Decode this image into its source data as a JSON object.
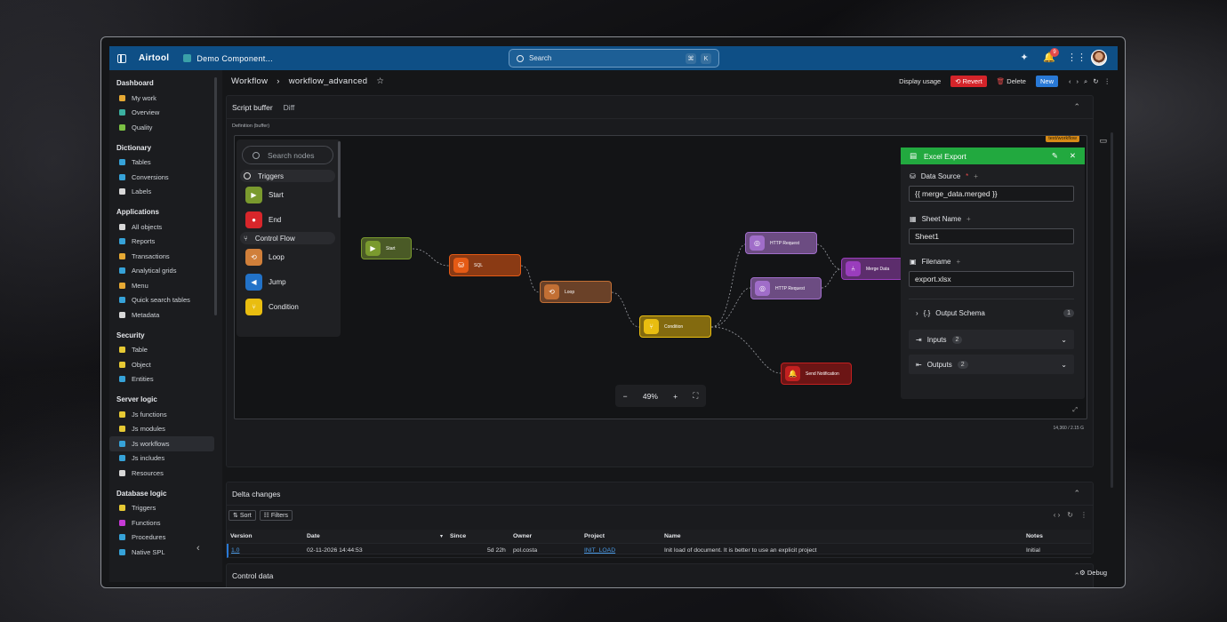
{
  "app": {
    "brand": "Airtool",
    "project": "Demo Component...",
    "search_placeholder": "Search",
    "kbd1": "⌘",
    "kbd2": "K",
    "notif_count": "9"
  },
  "sidebar": {
    "groups": [
      {
        "title": "Dashboard",
        "items": [
          {
            "label": "My work",
            "color": "#e6a934"
          },
          {
            "label": "Overview",
            "color": "#3bb0a0"
          },
          {
            "label": "Quality",
            "color": "#7bc043"
          }
        ]
      },
      {
        "title": "Dictionary",
        "items": [
          {
            "label": "Tables",
            "color": "#36a2d8"
          },
          {
            "label": "Conversions",
            "color": "#36a2d8"
          },
          {
            "label": "Labels",
            "color": "#d8d8d8"
          }
        ]
      },
      {
        "title": "Applications",
        "items": [
          {
            "label": "All objects",
            "color": "#d8d8d8"
          },
          {
            "label": "Reports",
            "color": "#36a2d8"
          },
          {
            "label": "Transactions",
            "color": "#e6a934"
          },
          {
            "label": "Analytical grids",
            "color": "#36a2d8"
          },
          {
            "label": "Menu",
            "color": "#e6a934"
          },
          {
            "label": "Quick search tables",
            "color": "#36a2d8"
          },
          {
            "label": "Metadata",
            "color": "#d8d8d8"
          }
        ]
      },
      {
        "title": "Security",
        "items": [
          {
            "label": "Table",
            "color": "#e6c934"
          },
          {
            "label": "Object",
            "color": "#e6c934"
          },
          {
            "label": "Entities",
            "color": "#36a2d8"
          }
        ]
      },
      {
        "title": "Server logic",
        "items": [
          {
            "label": "Js functions",
            "color": "#e6c934"
          },
          {
            "label": "Js modules",
            "color": "#e6c934"
          },
          {
            "label": "Js workflows",
            "color": "#36a2d8"
          },
          {
            "label": "Js includes",
            "color": "#36a2d8"
          },
          {
            "label": "Resources",
            "color": "#d8d8d8"
          }
        ]
      },
      {
        "title": "Database logic",
        "items": [
          {
            "label": "Triggers",
            "color": "#e6c934"
          },
          {
            "label": "Functions",
            "color": "#c63ad6"
          },
          {
            "label": "Procedures",
            "color": "#36a2d8"
          },
          {
            "label": "Native SPL",
            "color": "#36a2d8"
          }
        ]
      }
    ]
  },
  "header": {
    "crumb1": "Workflow",
    "crumb_sep": "›",
    "crumb2": "workflow_advanced",
    "star": "☆",
    "display_usage": "Display usage",
    "revert": "Revert",
    "delete": "Delete",
    "new": "New"
  },
  "script_panel": {
    "tab1": "Script buffer",
    "tab2": "Diff",
    "definition_label": "Definition (buffer)",
    "type_tag": "text/workflow",
    "size": "14,360 / 2.15 G"
  },
  "palette": {
    "search": "Search nodes",
    "sec1": "Triggers",
    "triggers": [
      {
        "label": "Start",
        "color": "#7a9a2e"
      },
      {
        "label": "End",
        "color": "#d8262b"
      }
    ],
    "sec2": "Control Flow",
    "flow": [
      {
        "label": "Loop",
        "color": "#d07f3a"
      },
      {
        "label": "Jump",
        "color": "#2272c8"
      },
      {
        "label": "Condition",
        "color": "#e9bd10"
      }
    ]
  },
  "nodes": [
    {
      "label": "Start",
      "bg": "#4a5a26",
      "ic": "#7a9a2e"
    },
    {
      "label": "SQL",
      "bg": "#8a3a14",
      "ic": "#e55a14"
    },
    {
      "label": "Loop",
      "bg": "#6a4128",
      "ic": "#c26f34"
    },
    {
      "label": "Condition",
      "bg": "#836a0f",
      "ic": "#e9bd10"
    },
    {
      "label": "HTTP Request",
      "bg": "#6c4c82",
      "ic": "#a06dc9"
    },
    {
      "label": "HTTP Request",
      "bg": "#6c4c82",
      "ic": "#a06dc9"
    },
    {
      "label": "Merge Data",
      "bg": "#5c2d6c",
      "ic": "#9a3dbd"
    },
    {
      "label": "Send Notification",
      "bg": "#6c1515",
      "ic": "#c22020"
    }
  ],
  "zoom": {
    "minus": "−",
    "value": "49%",
    "plus": "+"
  },
  "props": {
    "title": "Excel Export",
    "ds_label": "Data Source",
    "ds_value": "{{ merge_data.merged }}",
    "sheet_label": "Sheet Name",
    "sheet_value": "Sheet1",
    "file_label": "Filename",
    "file_value": "export.xlsx",
    "schema_label": "Output Schema",
    "schema_count": "1",
    "inputs_label": "Inputs",
    "inputs_count": "2",
    "outputs_label": "Outputs",
    "outputs_count": "2"
  },
  "delta": {
    "title": "Delta changes",
    "sort": "Sort",
    "filters": "Filters",
    "columns": {
      "version": "Version",
      "date": "Date",
      "since": "Since",
      "owner": "Owner",
      "project": "Project",
      "name": "Name",
      "notes": "Notes"
    },
    "rows": [
      {
        "version": "1.0",
        "date": "02-11-2026 14:44:53",
        "since": "5d 22h",
        "owner": "pol.costa",
        "project": "INIT_LOAD",
        "name": "Init load of document. It is better to use an explicit project",
        "notes": "Initial"
      }
    ]
  },
  "control": {
    "title": "Control data"
  },
  "debug": "Debug"
}
